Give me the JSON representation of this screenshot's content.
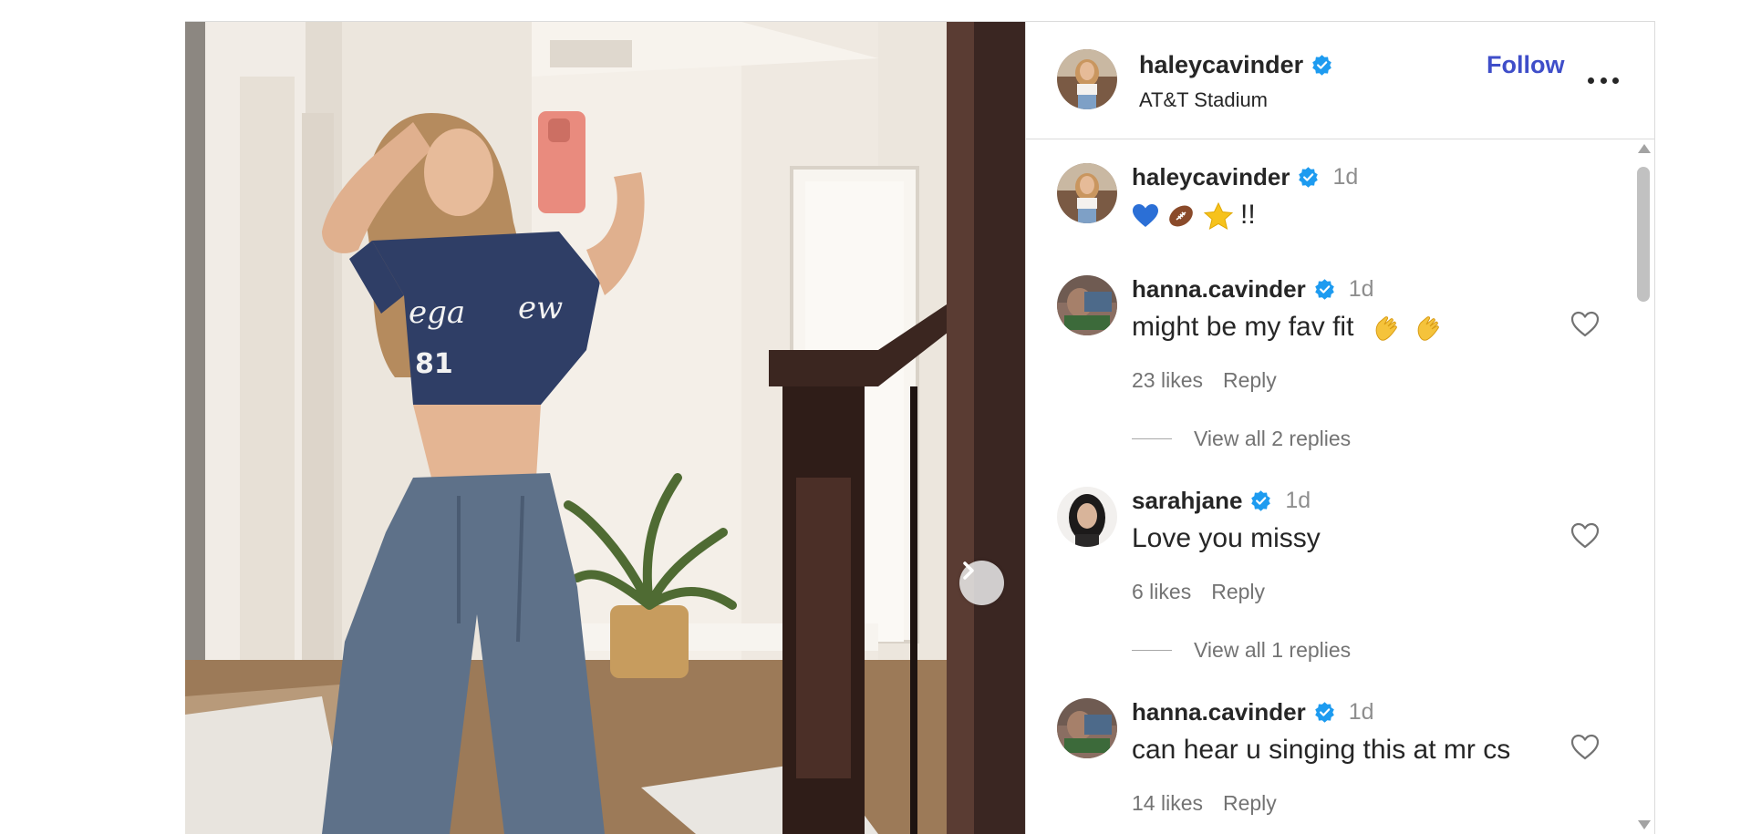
{
  "header": {
    "username": "haleycavinder",
    "location": "AT&T Stadium",
    "follow_label": "Follow"
  },
  "caption": {
    "username": "haleycavinder",
    "time": "1d",
    "text_suffix": "!!",
    "emojis": [
      "blue-heart",
      "football",
      "star"
    ]
  },
  "comments": [
    {
      "username": "hanna.cavinder",
      "time": "1d",
      "text": "might be my fav fit",
      "emojis": [
        "clapping-hands",
        "clapping-hands"
      ],
      "likes": "23 likes",
      "reply_label": "Reply",
      "view_replies": "View all 2 replies"
    },
    {
      "username": "sarahjane",
      "time": "1d",
      "text": "Love you missy",
      "likes": "6 likes",
      "reply_label": "Reply",
      "view_replies": "View all 1 replies"
    },
    {
      "username": "hanna.cavinder",
      "time": "1d",
      "text": "can hear u singing this at mr cs",
      "likes": "14 likes",
      "reply_label": "Reply"
    }
  ],
  "colors": {
    "follow": "#3f4ec9",
    "verified": "#1d9bf0",
    "muted": "#737373"
  }
}
